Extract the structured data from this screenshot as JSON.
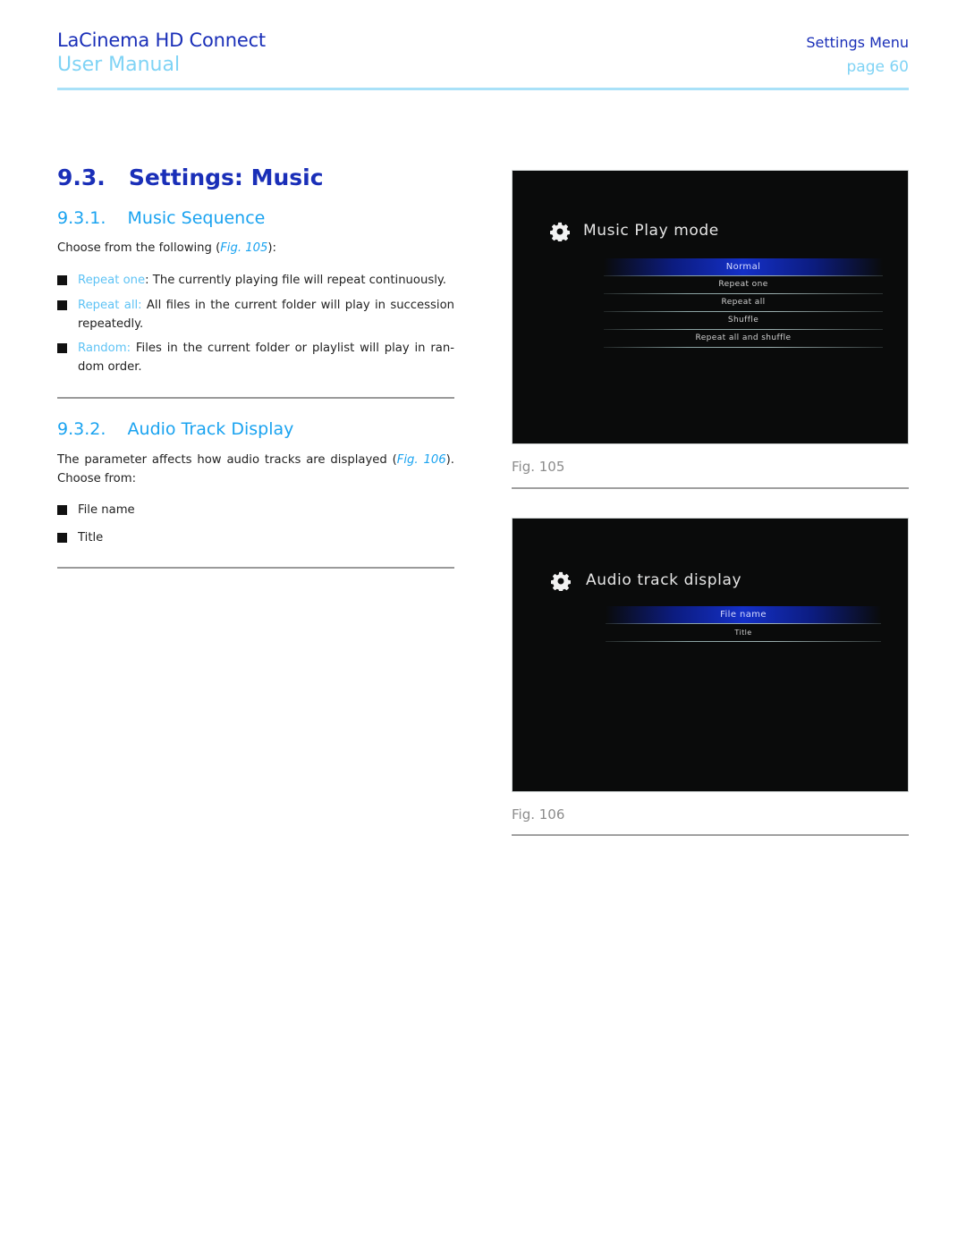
{
  "header": {
    "product": "LaCinema HD Connect",
    "doc_type": "User Manual",
    "section": "Settings Menu",
    "page": "page 60"
  },
  "section": {
    "number": "9.3.",
    "title": "Settings: Music",
    "heading": "9.3.   Settings: Music"
  },
  "music_sequence": {
    "heading": "9.3.1.    Music Sequence",
    "intro_before": "Choose from the following (",
    "intro_link": "Fig. 105",
    "intro_after": "):",
    "items": [
      {
        "term": "Repeat one",
        "sep": ":",
        "text": " The currently playing file will repeat continuously."
      },
      {
        "term": "Repeat all:",
        "sep": "",
        "text": " All files in the current folder will play in succession repeatedly."
      },
      {
        "term": "Random:",
        "sep": "",
        "text": " Files in the current folder or playlist will play in ran- dom order."
      }
    ]
  },
  "audio_track_display": {
    "heading": "9.3.2.    Audio Track Display",
    "intro_before": "The parameter affects how audio tracks are displayed (",
    "intro_link": "Fig. 106",
    "intro_after": "). Choose from:",
    "items": [
      "File name",
      "Title"
    ]
  },
  "figures": [
    {
      "caption": "Fig. 105",
      "screen_title": "Music Play mode",
      "icon": "gear-icon",
      "selected_index": 0,
      "options": [
        "Normal",
        "Repeat one",
        "Repeat all",
        "Shuffle",
        "Repeat all and shuffle"
      ]
    },
    {
      "caption": "Fig. 106",
      "screen_title": "Audio track display",
      "icon": "gear-icon",
      "selected_index": 0,
      "options": [
        "File name",
        "Title"
      ]
    }
  ],
  "colors": {
    "primary_blue": "#1a2fb8",
    "light_blue": "#7fd3f5",
    "heading_blue": "#1aa3f0",
    "menu_highlight": "#1430c8"
  }
}
